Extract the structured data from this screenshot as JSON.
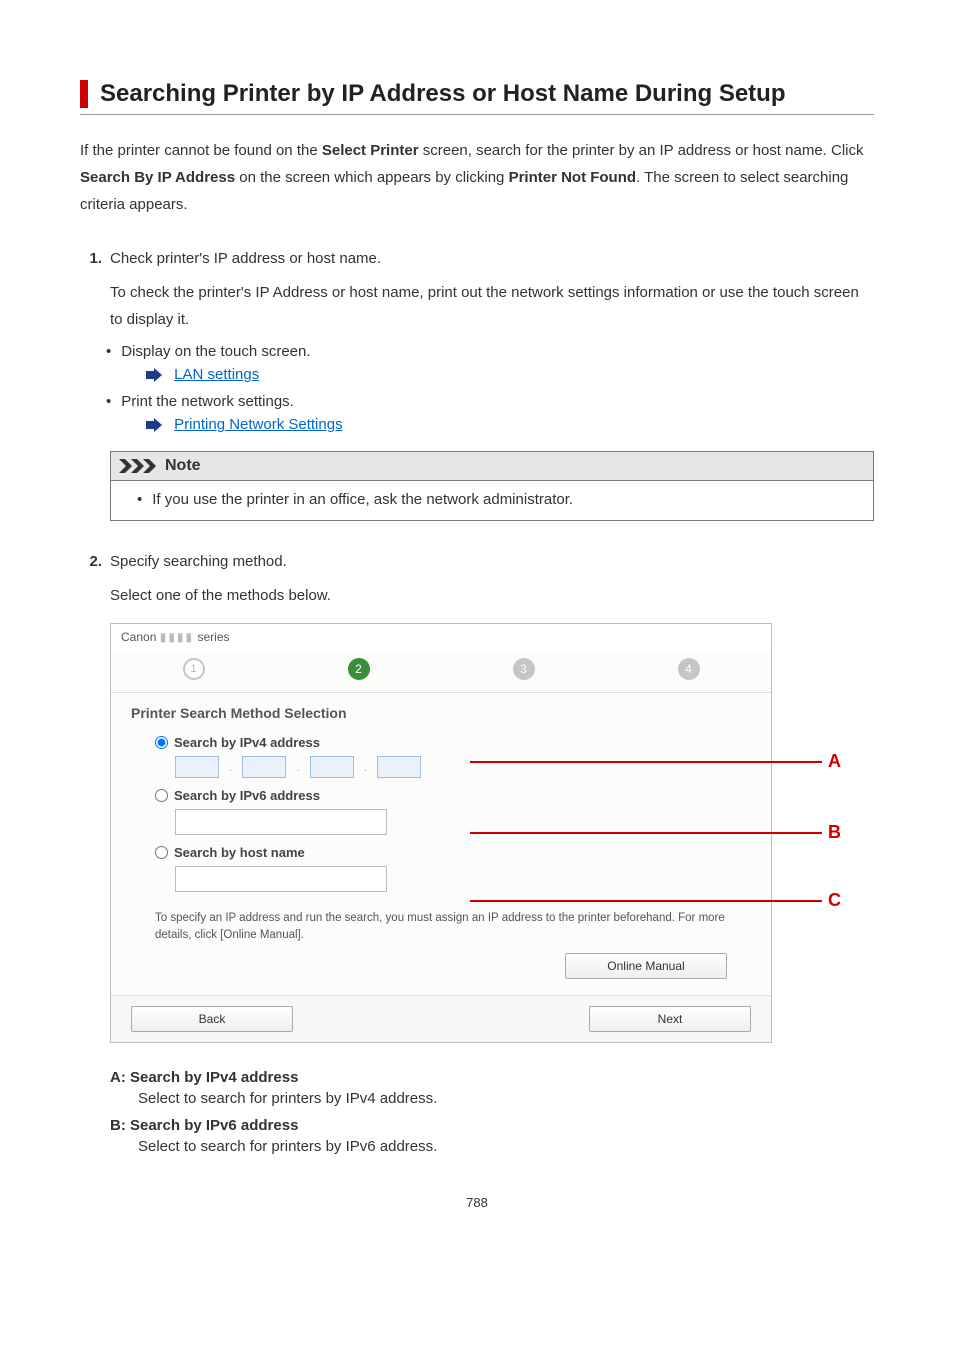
{
  "title": "Searching Printer by IP Address or Host Name During Setup",
  "intro": {
    "pre1": "If the printer cannot be found on the ",
    "b1": "Select Printer",
    "mid1": " screen, search for the printer by an IP address or host name. Click ",
    "b2": "Search By IP Address",
    "mid2": " on the screen which appears by clicking ",
    "b3": "Printer Not Found",
    "post": ". The screen to select searching criteria appears."
  },
  "step1": {
    "num": "1.",
    "text": "Check printer's IP address or host name.",
    "body": "To check the printer's IP Address or host name, print out the network settings information or use the touch screen to display it.",
    "bullets": {
      "b1": "Display on the touch screen.",
      "link1": "LAN settings",
      "b2": "Print the network settings.",
      "link2": "Printing Network Settings"
    }
  },
  "note": {
    "label": "Note",
    "item1": "If you use the printer in an office, ask the network administrator."
  },
  "step2": {
    "num": "2.",
    "text": "Specify searching method.",
    "body": "Select one of the methods below."
  },
  "dialog": {
    "brand": "Canon",
    "series": "series",
    "steps": {
      "s1": "1",
      "s2": "2",
      "s3": "3",
      "s4": "4"
    },
    "section": "Printer Search Method Selection",
    "optA": "Search by IPv4 address",
    "optB": "Search by IPv6 address",
    "optC": "Search by host name",
    "hint": "To specify an IP address and run the search, you must assign an IP address to the printer beforehand. For more details, click [Online Manual].",
    "btn_online": "Online Manual",
    "btn_back": "Back",
    "btn_next": "Next"
  },
  "ann": {
    "A": "A",
    "B": "B",
    "C": "C"
  },
  "defs": {
    "Ah": "A: Search by IPv4 address",
    "Ad": "Select to search for printers by IPv4 address.",
    "Bh": "B: Search by IPv6 address",
    "Bd": "Select to search for printers by IPv6 address."
  },
  "page_number": "788"
}
